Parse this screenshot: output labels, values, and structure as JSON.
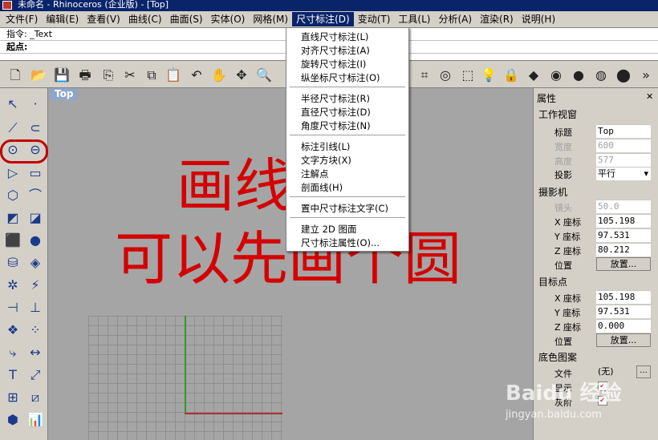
{
  "window": {
    "title": "未命名 - Rhinoceros (企业版) - [Top]"
  },
  "menubar": {
    "items": [
      {
        "label": "文件(F)"
      },
      {
        "label": "编辑(E)"
      },
      {
        "label": "查看(V)"
      },
      {
        "label": "曲线(C)"
      },
      {
        "label": "曲面(S)"
      },
      {
        "label": "实体(O)"
      },
      {
        "label": "网格(M)"
      },
      {
        "label": "尺寸标注(D)"
      },
      {
        "label": "变动(T)"
      },
      {
        "label": "工具(L)"
      },
      {
        "label": "分析(A)"
      },
      {
        "label": "渲染(R)"
      },
      {
        "label": "说明(H)"
      }
    ]
  },
  "command": {
    "line1": "指令: _Text",
    "line2": "起点:"
  },
  "dropdown": {
    "items": [
      "直线尺寸标注(L)",
      "对齐尺寸标注(A)",
      "旋转尺寸标注(I)",
      "纵坐标尺寸标注(O)",
      "半径尺寸标注(R)",
      "直径尺寸标注(D)",
      "角度尺寸标注(N)",
      "标注引线(L)",
      "文字方块(X)",
      "注解点",
      "剖面线(H)",
      "置中尺寸标注文字(C)",
      "建立 2D 图面",
      "尺寸标注属性(O)..."
    ]
  },
  "viewport": {
    "label": "Top"
  },
  "overlay": {
    "line1": "画线工具",
    "line2": "可以先画个圆"
  },
  "properties": {
    "title": "属性",
    "close": "✕",
    "viewport_section": "工作视窗",
    "title_label": "标题",
    "title_value": "Top",
    "width_label": "宽度",
    "width_value": "600",
    "height_label": "高度",
    "height_value": "577",
    "projection_label": "投影",
    "projection_value": "平行",
    "camera_section": "摄影机",
    "lens_label": "镜头",
    "lens_value": "50.0",
    "cam_x_label": "X 座标",
    "cam_x_value": "105.198",
    "cam_y_label": "Y 座标",
    "cam_y_value": "97.531",
    "cam_z_label": "Z 座标",
    "cam_z_value": "80.212",
    "cam_pos_label": "位置",
    "cam_pos_button": "放置...",
    "target_section": "目标点",
    "tgt_x_label": "X 座标",
    "tgt_x_value": "105.198",
    "tgt_y_label": "Y 座标",
    "tgt_y_value": "97.531",
    "tgt_z_label": "Z 座标",
    "tgt_z_value": "0.000",
    "tgt_pos_label": "位置",
    "tgt_pos_button": "放置...",
    "bg_section": "底色图案",
    "file_label": "文件",
    "file_value": "(无)",
    "file_button": "...",
    "show_label": "显示",
    "gray_label": "灰阶"
  },
  "watermark": {
    "text": "Baidu 经验",
    "url": "jingyan.baidu.com"
  }
}
